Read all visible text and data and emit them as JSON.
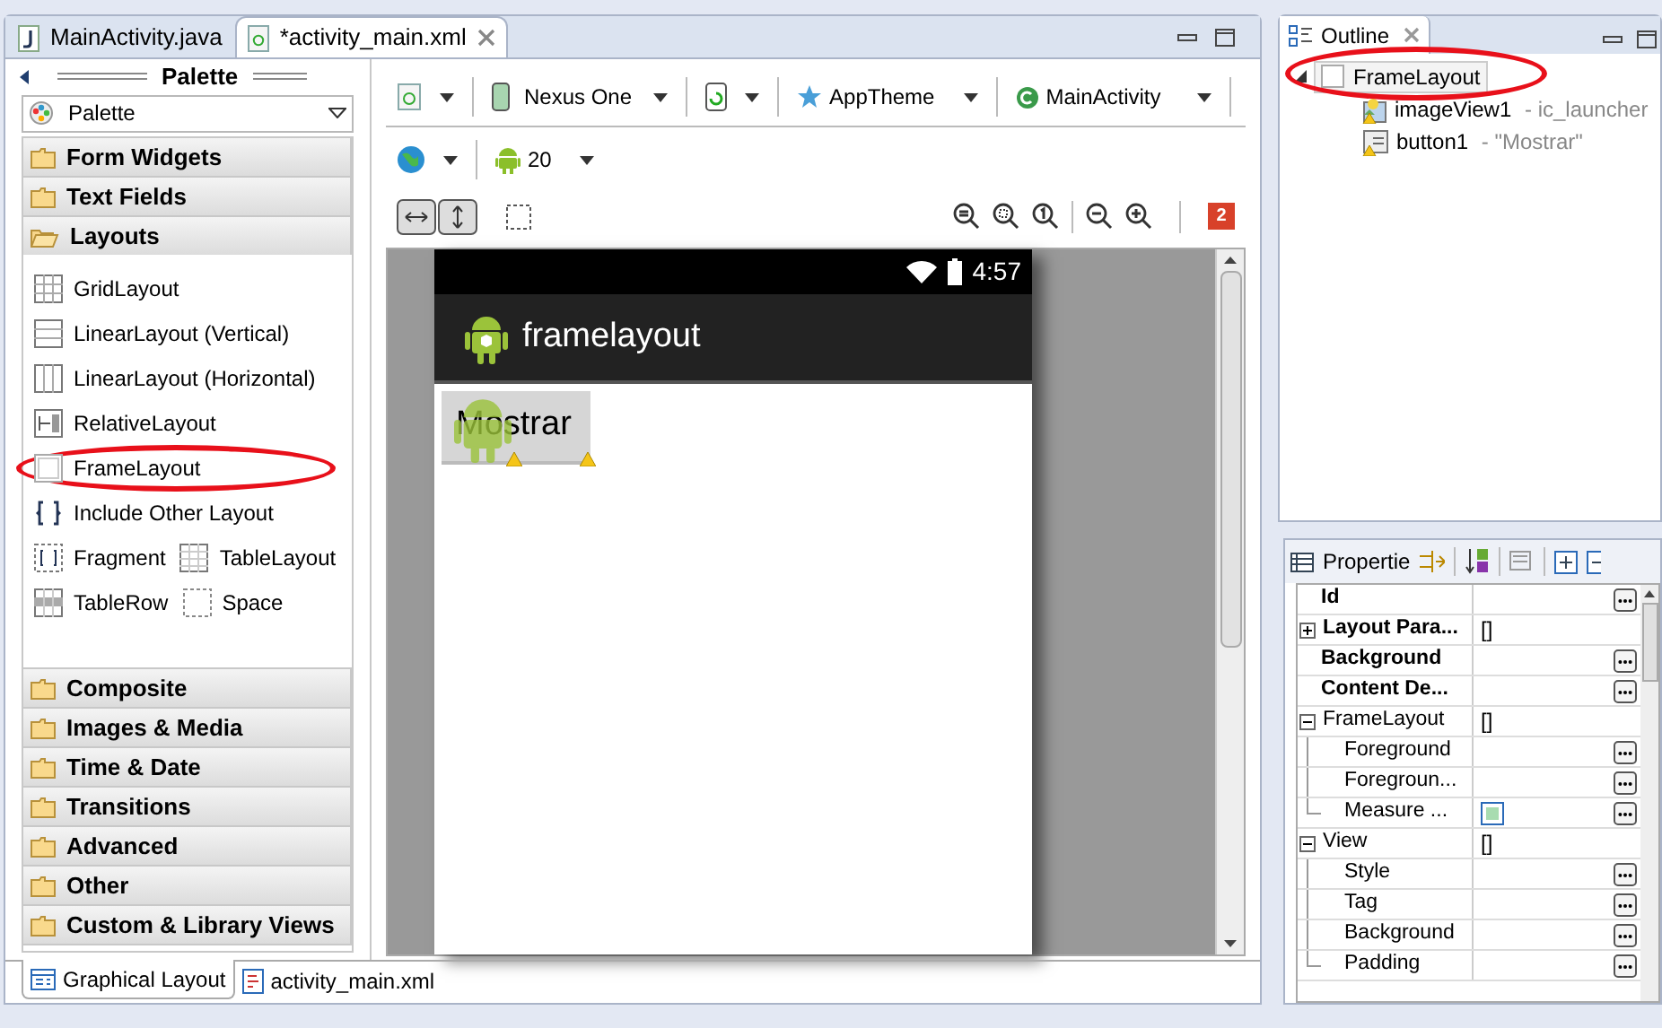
{
  "editor_tabs": [
    {
      "label": "MainActivity.java",
      "selected": false
    },
    {
      "label": "*activity_main.xml",
      "selected": true
    }
  ],
  "palette": {
    "title": "Palette",
    "dropdown": "Palette",
    "categories": [
      {
        "label": "Form Widgets",
        "expanded": false
      },
      {
        "label": "Text Fields",
        "expanded": false
      },
      {
        "label": "Layouts",
        "expanded": true,
        "rows": [
          [
            {
              "label": "GridLayout",
              "annotated": false
            }
          ],
          [
            {
              "label": "LinearLayout (Vertical)",
              "annotated": false
            }
          ],
          [
            {
              "label": "LinearLayout (Horizontal)",
              "annotated": false
            }
          ],
          [
            {
              "label": "RelativeLayout",
              "annotated": false
            }
          ],
          [
            {
              "label": "FrameLayout",
              "annotated": true
            }
          ],
          [
            {
              "label": "Include Other Layout",
              "annotated": false
            }
          ],
          [
            {
              "label": "Fragment",
              "annotated": false
            },
            {
              "label": "TableLayout",
              "annotated": false
            }
          ],
          [
            {
              "label": "TableRow",
              "annotated": false
            },
            {
              "label": "Space",
              "annotated": false
            }
          ]
        ]
      },
      {
        "label": "Composite",
        "expanded": false
      },
      {
        "label": "Images & Media",
        "expanded": false
      },
      {
        "label": "Time & Date",
        "expanded": false
      },
      {
        "label": "Transitions",
        "expanded": false
      },
      {
        "label": "Advanced",
        "expanded": false
      },
      {
        "label": "Other",
        "expanded": false
      },
      {
        "label": "Custom & Library Views",
        "expanded": false
      }
    ]
  },
  "toolbar": {
    "device": "Nexus One",
    "theme": "AppTheme",
    "activity": "MainActivity",
    "api_level": "20",
    "error_count": "2"
  },
  "preview": {
    "time": "4:57",
    "app_title": "framelayout",
    "button": "Mostrar"
  },
  "bottom_tabs": [
    {
      "label": "Graphical Layout",
      "selected": true
    },
    {
      "label": "activity_main.xml",
      "selected": false
    }
  ],
  "outline": {
    "title": "Outline",
    "tree": [
      {
        "label": "FrameLayout",
        "expanded": true,
        "annotated": true,
        "selected": true,
        "children": [
          {
            "label": "imageView1",
            "detail": " - ic_launcher",
            "selected": false
          },
          {
            "label": "button1",
            "detail": " - \"Mostrar\"",
            "selected": false
          }
        ]
      }
    ]
  },
  "properties": {
    "title": "Propertie",
    "rows": [
      {
        "kind": "property",
        "name": "Id",
        "bold": true
      },
      {
        "kind": "group",
        "name": "Layout Para...",
        "bold": true,
        "expanded": false,
        "value": "[]"
      },
      {
        "kind": "property",
        "name": "Background",
        "bold": true
      },
      {
        "kind": "property",
        "name": "Content De...",
        "bold": true
      },
      {
        "kind": "group",
        "name": "FrameLayout",
        "bold": false,
        "expanded": true,
        "value": "[]",
        "children": [
          {
            "kind": "property",
            "name": "Foreground",
            "bold": false
          },
          {
            "kind": "property",
            "name": "Foregroun...",
            "bold": false
          },
          {
            "kind": "checkbox",
            "name": "Measure ...",
            "bold": false,
            "checked": true
          }
        ]
      },
      {
        "kind": "group",
        "name": "View",
        "bold": false,
        "expanded": true,
        "value": "[]",
        "children": [
          {
            "kind": "property",
            "name": "Style",
            "bold": false
          },
          {
            "kind": "property",
            "name": "Tag",
            "bold": false
          },
          {
            "kind": "property",
            "name": "Background",
            "bold": false
          },
          {
            "kind": "property",
            "name": "Padding",
            "bold": false
          }
        ]
      }
    ]
  }
}
